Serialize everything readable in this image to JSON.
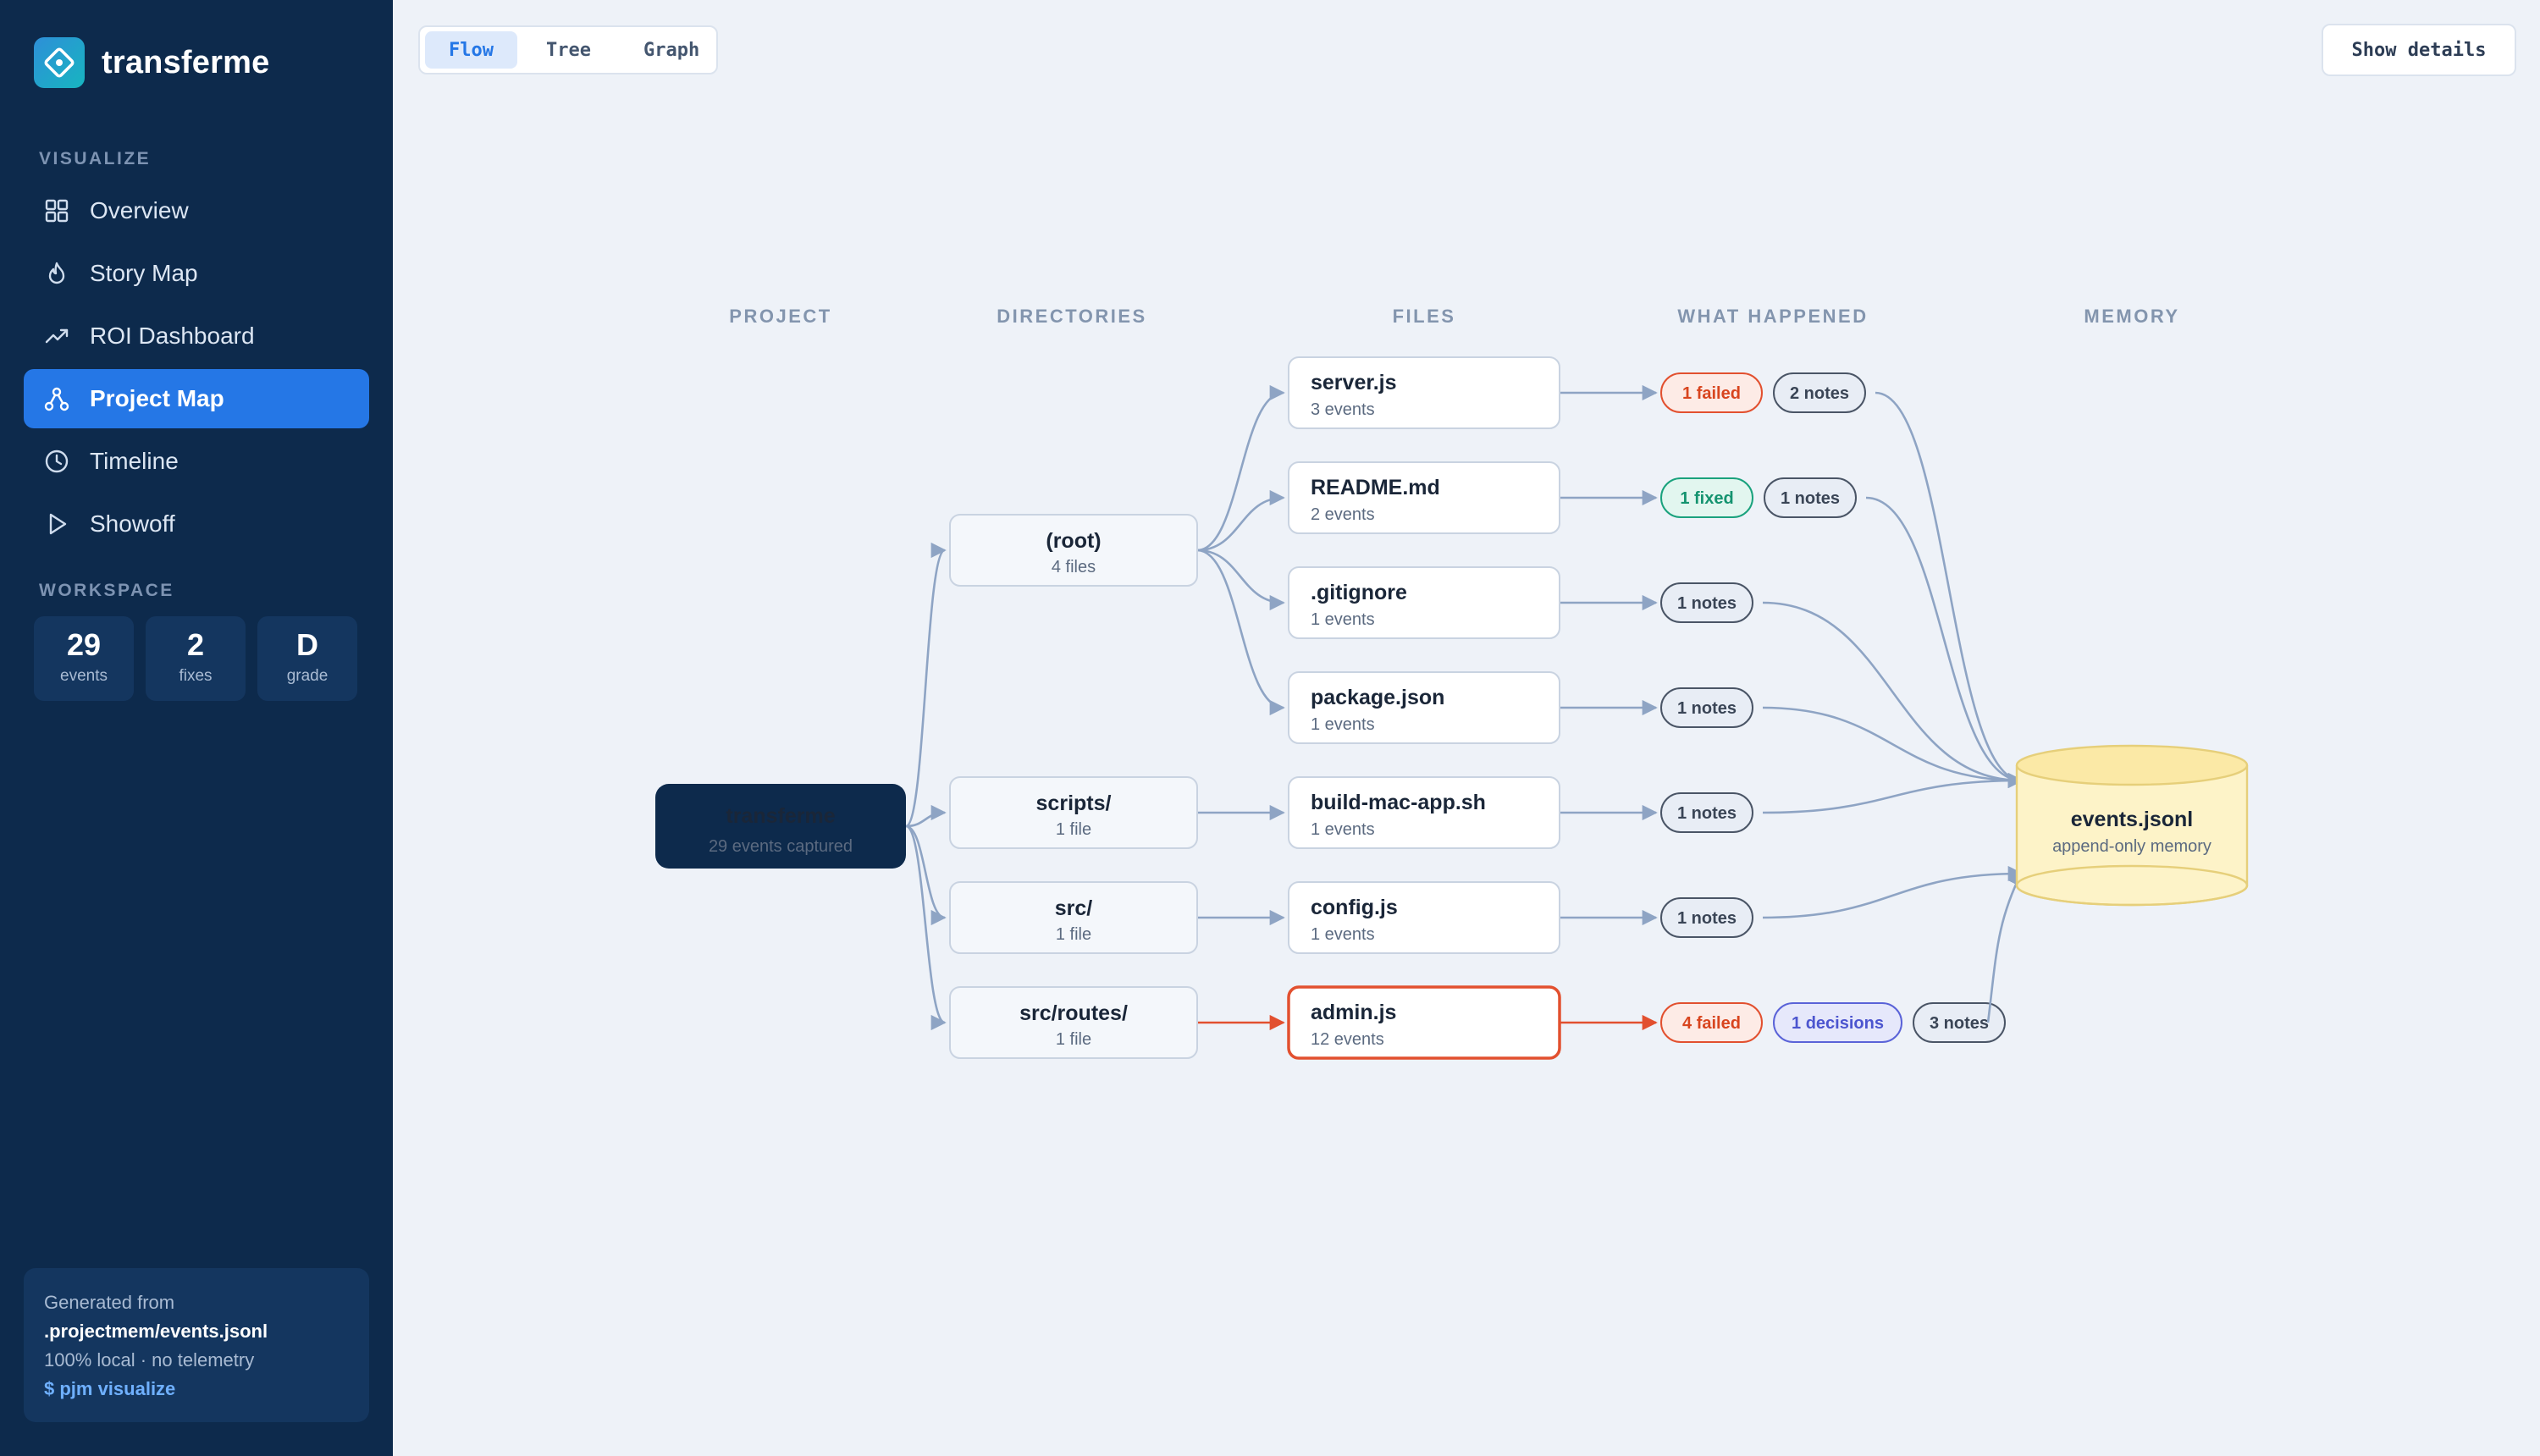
{
  "app": {
    "name": "transferme"
  },
  "sidebar": {
    "visualize_title": "VISUALIZE",
    "items": [
      {
        "label": "Overview",
        "icon": "grid-icon"
      },
      {
        "label": "Story Map",
        "icon": "flame-icon"
      },
      {
        "label": "ROI Dashboard",
        "icon": "trend-icon"
      },
      {
        "label": "Project Map",
        "icon": "graph-icon",
        "active": true
      },
      {
        "label": "Timeline",
        "icon": "clock-icon"
      },
      {
        "label": "Showoff",
        "icon": "play-icon"
      }
    ],
    "workspace_title": "WORKSPACE",
    "stats": [
      {
        "value": "29",
        "label": "events"
      },
      {
        "value": "2",
        "label": "fixes"
      },
      {
        "value": "D",
        "label": "grade"
      }
    ],
    "footer": {
      "line1": "Generated from",
      "line2": ".projectmem/events.jsonl",
      "line3": "100% local · no telemetry",
      "line4": "$ pjm visualize"
    }
  },
  "toolbar": {
    "tabs": [
      {
        "label": "Flow",
        "active": true
      },
      {
        "label": "Tree"
      },
      {
        "label": "Graph"
      }
    ],
    "show_details_label": "Show details"
  },
  "flow": {
    "columns": [
      "PROJECT",
      "DIRECTORIES",
      "FILES",
      "WHAT HAPPENED",
      "MEMORY"
    ],
    "project": {
      "name": "transferme",
      "sub": "29 events captured"
    },
    "directories": [
      {
        "name": "(root)",
        "sub": "4 files"
      },
      {
        "name": "scripts/",
        "sub": "1 file"
      },
      {
        "name": "src/",
        "sub": "1 file"
      },
      {
        "name": "src/routes/",
        "sub": "1 file"
      }
    ],
    "files": [
      {
        "name": "server.js",
        "sub": "3 events",
        "dir": 0,
        "pills": [
          {
            "text": "1 failed",
            "kind": "failed"
          },
          {
            "text": "2 notes",
            "kind": "notes"
          }
        ]
      },
      {
        "name": "README.md",
        "sub": "2 events",
        "dir": 0,
        "pills": [
          {
            "text": "1 fixed",
            "kind": "fixed"
          },
          {
            "text": "1 notes",
            "kind": "notes"
          }
        ]
      },
      {
        "name": ".gitignore",
        "sub": "1 events",
        "dir": 0,
        "pills": [
          {
            "text": "1 notes",
            "kind": "notes"
          }
        ]
      },
      {
        "name": "package.json",
        "sub": "1 events",
        "dir": 0,
        "pills": [
          {
            "text": "1 notes",
            "kind": "notes"
          }
        ]
      },
      {
        "name": "build-mac-app.sh",
        "sub": "1 events",
        "dir": 1,
        "pills": [
          {
            "text": "1 notes",
            "kind": "notes"
          }
        ]
      },
      {
        "name": "config.js",
        "sub": "1 events",
        "dir": 2,
        "pills": [
          {
            "text": "1 notes",
            "kind": "notes"
          }
        ]
      },
      {
        "name": "admin.js",
        "sub": "12 events",
        "dir": 3,
        "hot": true,
        "pills": [
          {
            "text": "4 failed",
            "kind": "failed"
          },
          {
            "text": "1 decisions",
            "kind": "decisions"
          },
          {
            "text": "3 notes",
            "kind": "notes"
          }
        ]
      }
    ],
    "memory": {
      "name": "events.jsonl",
      "sub": "append-only memory"
    },
    "colors": {
      "edge": "#8ea4c4",
      "hot_edge": "#e2502f",
      "project_fill": "#0d2a4c",
      "failed": "#e2502f",
      "fixed": "#1aa27d",
      "decisions": "#5a63d8",
      "notes": "#4a5566",
      "memory_fill": "#fdf3c8",
      "memory_stroke": "#e6cf7a"
    }
  }
}
